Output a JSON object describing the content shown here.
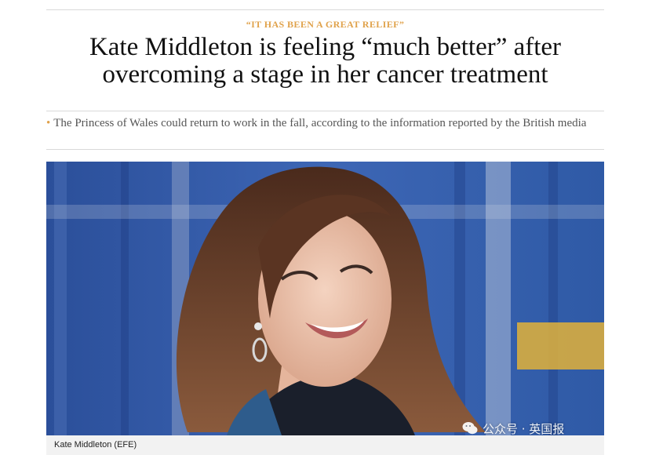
{
  "article": {
    "kicker": "“IT HAS BEEN A GREAT RELIEF”",
    "headline_line1": "Kate Middleton is feeling “much better” after",
    "headline_line2": "overcoming a stage in her cancer treatment",
    "subline": "The Princess of Wales could return to work in the fall, according to the information reported by the British media",
    "bullet": "•"
  },
  "photo": {
    "caption": "Kate Middleton (EFE)"
  },
  "watermark": {
    "text": "公众号 · 英国报"
  },
  "colors": {
    "accent": "#e0a24b",
    "rule": "#d9d9d9",
    "caption_bg": "#f2f2f2"
  }
}
